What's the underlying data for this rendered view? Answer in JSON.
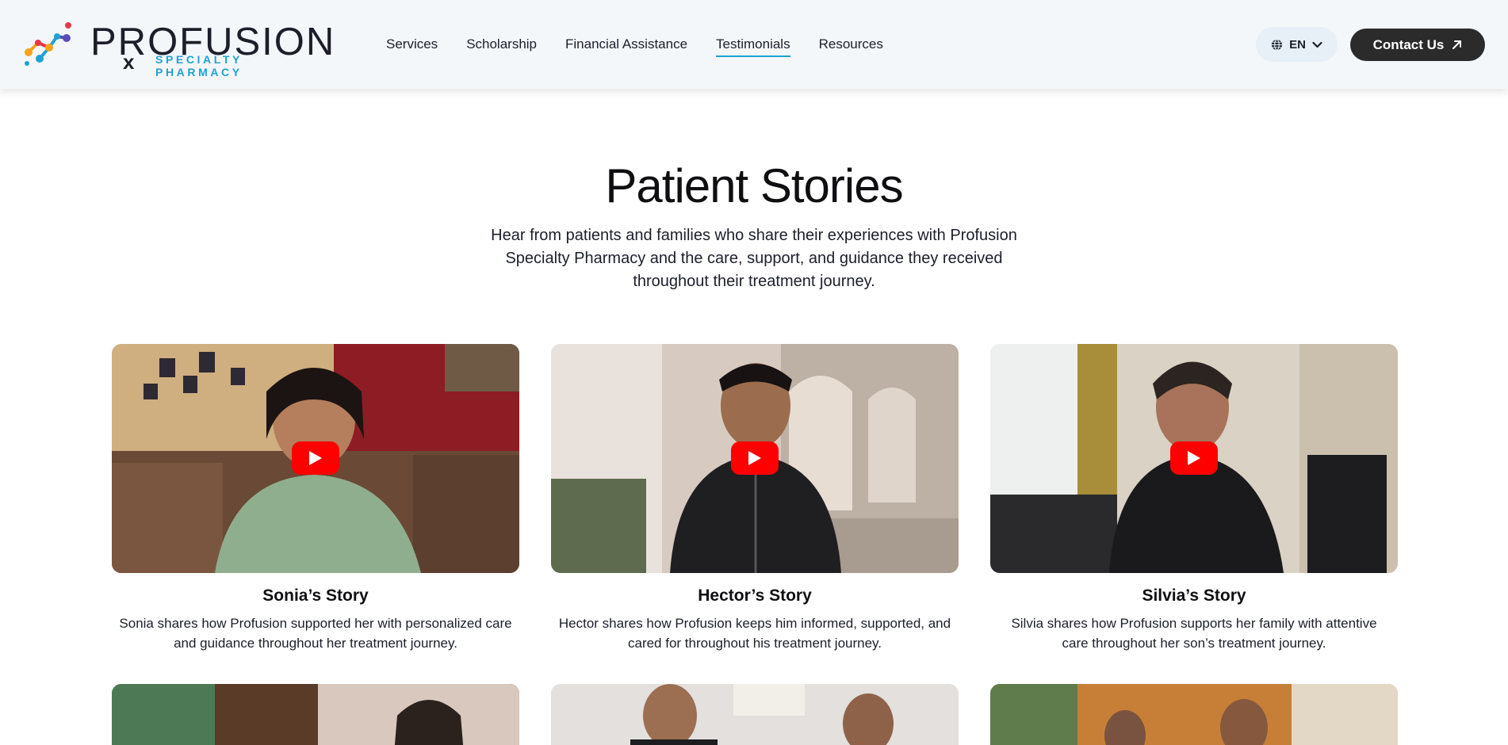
{
  "brand": {
    "wordmark": "PROFUSION",
    "rx_mark": "x",
    "tagline": "SPECIALTY PHARMACY"
  },
  "nav": {
    "items": [
      {
        "label": "Services"
      },
      {
        "label": "Scholarship"
      },
      {
        "label": "Financial Assistance"
      },
      {
        "label": "Testimonials",
        "active": true
      },
      {
        "label": "Resources"
      }
    ]
  },
  "language": {
    "label": "EN",
    "icon": "globe-icon"
  },
  "contact": {
    "label": "Contact Us",
    "icon": "arrow-up-right-icon"
  },
  "intro": {
    "title": "Patient Stories",
    "subtitle": "Hear from patients and families who share their experiences with Profusion Specialty Pharmacy and the care, support, and guidance they received throughout their treatment journey."
  },
  "stories": [
    {
      "title": "Sonia’s Story",
      "description": "Sonia shares how Profusion supported her with personalized care and guidance throughout her treatment journey."
    },
    {
      "title": "Hector’s Story",
      "description": "Hector shares how Profusion keeps him informed, supported, and cared for throughout his treatment journey."
    },
    {
      "title": "Silvia’s Story",
      "description": "Silvia shares how Profusion supports her family with attentive care throughout her son’s treatment journey."
    }
  ],
  "colors": {
    "accent": "#1ea2d3",
    "button_dark": "#2b2b2b",
    "play_red": "#ff0000",
    "header_bg": "#f4f7fa"
  }
}
